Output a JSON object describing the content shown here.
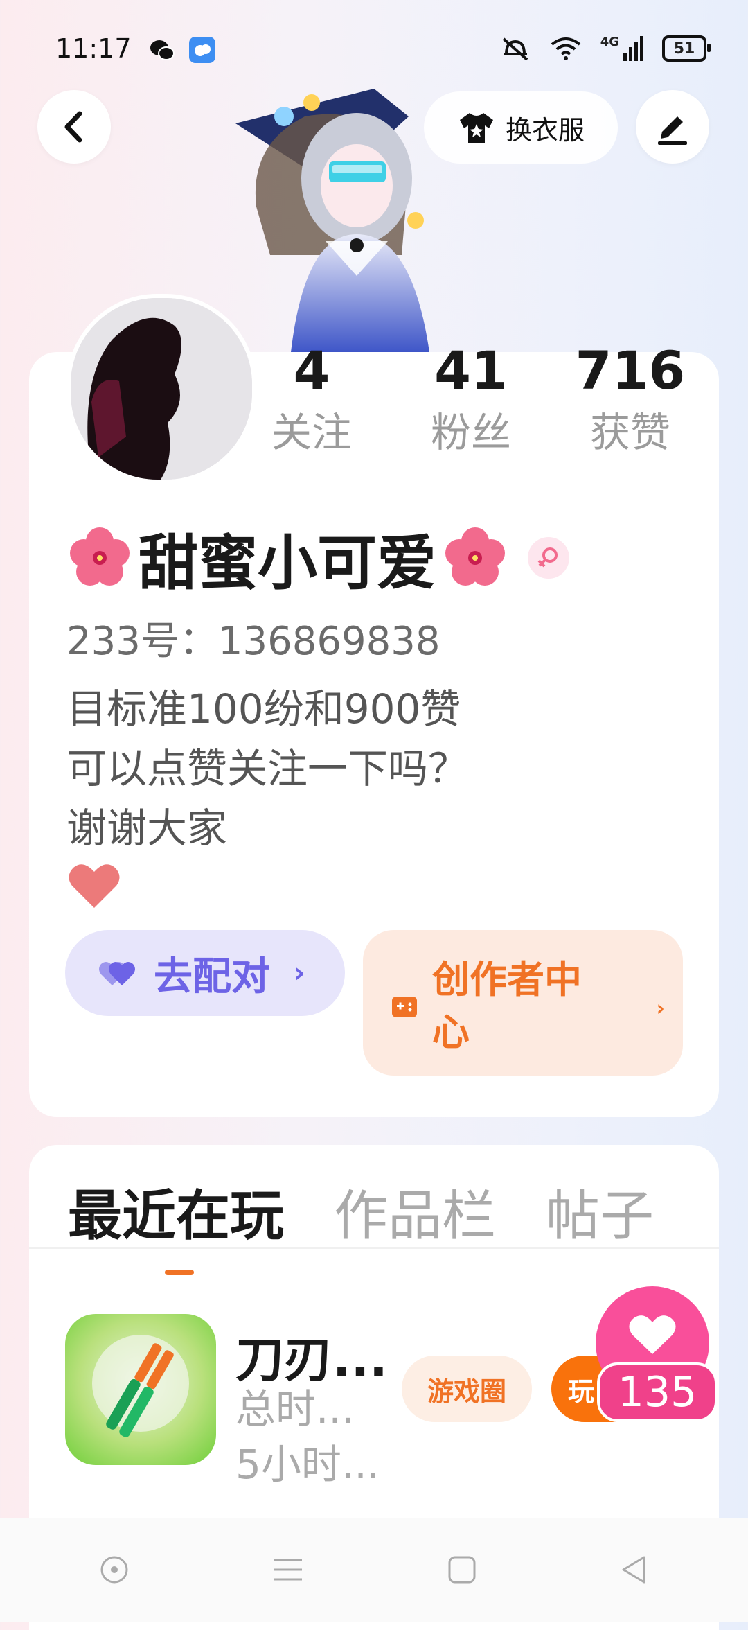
{
  "status_bar": {
    "time": "11:17",
    "battery": "51",
    "network": "4G"
  },
  "header": {
    "outfit_label": "换衣服"
  },
  "stats": [
    {
      "value": "4",
      "label": "关注"
    },
    {
      "value": "41",
      "label": "粉丝"
    },
    {
      "value": "716",
      "label": "获赞"
    }
  ],
  "profile": {
    "name": "甜蜜小可爱",
    "uid": "233号：136869838",
    "bio": [
      "目标准100纷和900赞",
      "可以点赞关注一下吗？",
      "谢谢大家"
    ]
  },
  "actions": {
    "match_label": "去配对",
    "creator_label": "创作者中心"
  },
  "tabs": [
    "最近在玩",
    "作品栏",
    "帖子"
  ],
  "game": {
    "name": "刀刃...",
    "subtitle": "总时...",
    "playtime": "5小时...",
    "tag_circle": "游戏圈",
    "tag_play": "玩"
  },
  "floating_like": {
    "count": "135"
  },
  "colors": {
    "accent": "#f07225",
    "match": "#6d63e6",
    "like": "#f94f9a"
  }
}
